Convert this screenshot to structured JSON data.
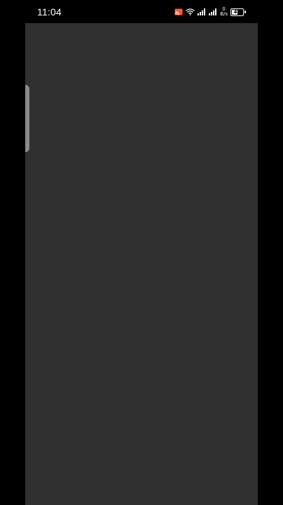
{
  "status_bar": {
    "time": "11:04",
    "net_speed_value": "0",
    "net_speed_unit": "B/s",
    "battery_level": "48",
    "battery_fraction": 0.48,
    "icons": [
      "cast-icon",
      "wifi-icon",
      "signal-icon",
      "signal-icon-2",
      "battery-icon"
    ]
  },
  "colors": {
    "background": "#000000",
    "panel": "#303030",
    "handle": "#8a8a8a",
    "cast_accent": "#ff5a36"
  }
}
